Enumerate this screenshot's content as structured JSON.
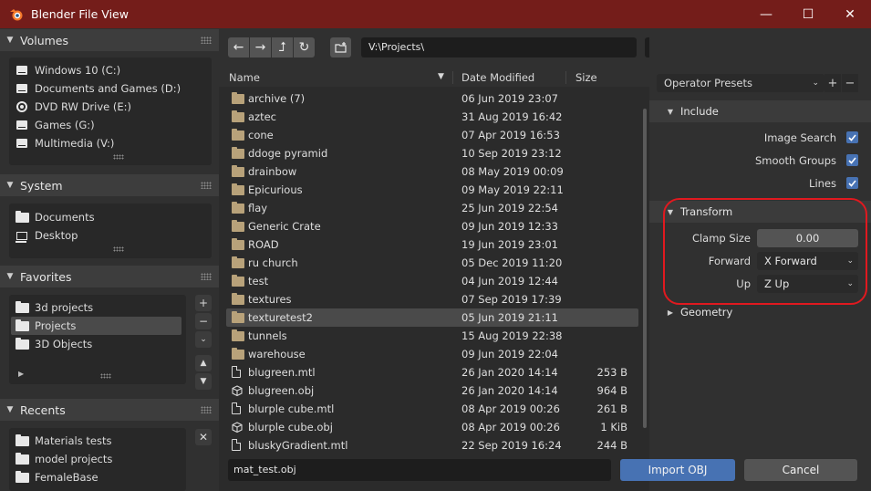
{
  "window": {
    "title": "Blender File View",
    "minimize": "—",
    "maximize": "☐",
    "close": "✕"
  },
  "sidebar": {
    "volumes": {
      "label": "Volumes",
      "items": [
        {
          "label": "Windows 10 (C:)",
          "icon": "drive-icon"
        },
        {
          "label": "Documents and Games (D:)",
          "icon": "drive-icon"
        },
        {
          "label": "DVD RW Drive (E:)",
          "icon": "disc-icon"
        },
        {
          "label": "Games (G:)",
          "icon": "drive-icon"
        },
        {
          "label": "Multimedia (V:)",
          "icon": "drive-icon"
        }
      ]
    },
    "system": {
      "label": "System",
      "items": [
        {
          "label": "Documents",
          "icon": "folder-icon"
        },
        {
          "label": "Desktop",
          "icon": "desktop-icon"
        }
      ]
    },
    "favorites": {
      "label": "Favorites",
      "items": [
        {
          "label": "3d projects",
          "icon": "folder-icon"
        },
        {
          "label": "Projects",
          "icon": "folder-icon",
          "selected": true
        },
        {
          "label": "3D Objects",
          "icon": "folder-icon"
        }
      ]
    },
    "recents": {
      "label": "Recents",
      "items": [
        {
          "label": "Materials tests",
          "icon": "folder-icon"
        },
        {
          "label": "model projects",
          "icon": "folder-icon"
        },
        {
          "label": "FemaleBase",
          "icon": "folder-icon"
        }
      ]
    }
  },
  "toolbar": {
    "path": "V:\\Projects\\"
  },
  "columns": {
    "name": "Name",
    "date": "Date Modified",
    "size": "Size"
  },
  "files": [
    {
      "name": "archive (7)",
      "date": "06 Jun 2019 23:07",
      "size": "",
      "type": "folder"
    },
    {
      "name": "aztec",
      "date": "31 Aug 2019 16:42",
      "size": "",
      "type": "folder"
    },
    {
      "name": "cone",
      "date": "07 Apr 2019 16:53",
      "size": "",
      "type": "folder"
    },
    {
      "name": "ddoge pyramid",
      "date": "10 Sep 2019 23:12",
      "size": "",
      "type": "folder"
    },
    {
      "name": "drainbow",
      "date": "08 May 2019 00:09",
      "size": "",
      "type": "folder"
    },
    {
      "name": "Epicurious",
      "date": "09 May 2019 22:11",
      "size": "",
      "type": "folder"
    },
    {
      "name": "flay",
      "date": "25 Jun 2019 22:54",
      "size": "",
      "type": "folder"
    },
    {
      "name": "Generic Crate",
      "date": "09 Jun 2019 12:33",
      "size": "",
      "type": "folder"
    },
    {
      "name": "ROAD",
      "date": "19 Jun 2019 23:01",
      "size": "",
      "type": "folder"
    },
    {
      "name": "ru church",
      "date": "05 Dec 2019 11:20",
      "size": "",
      "type": "folder"
    },
    {
      "name": "test",
      "date": "04 Jun 2019 12:44",
      "size": "",
      "type": "folder"
    },
    {
      "name": "textures",
      "date": "07 Sep 2019 17:39",
      "size": "",
      "type": "folder"
    },
    {
      "name": "texturetest2",
      "date": "05 Jun 2019 21:11",
      "size": "",
      "type": "folder",
      "selected": true
    },
    {
      "name": "tunnels",
      "date": "15 Aug 2019 22:38",
      "size": "",
      "type": "folder"
    },
    {
      "name": "warehouse",
      "date": "09 Jun 2019 22:04",
      "size": "",
      "type": "folder"
    },
    {
      "name": "blugreen.mtl",
      "date": "26 Jan 2020 14:14",
      "size": "253 B",
      "type": "file"
    },
    {
      "name": "blugreen.obj",
      "date": "26 Jan 2020 14:14",
      "size": "964 B",
      "type": "mesh"
    },
    {
      "name": "blurple cube.mtl",
      "date": "08 Apr 2019 00:26",
      "size": "261 B",
      "type": "file"
    },
    {
      "name": "blurple cube.obj",
      "date": "08 Apr 2019 00:26",
      "size": "1 KiB",
      "type": "mesh"
    },
    {
      "name": "bluskyGradient.mtl",
      "date": "22 Sep 2019 16:24",
      "size": "244 B",
      "type": "file"
    }
  ],
  "filename": "mat_test.obj",
  "operator": {
    "presets_label": "Operator Presets",
    "include": {
      "label": "Include",
      "options": [
        {
          "label": "Image Search",
          "checked": true
        },
        {
          "label": "Smooth Groups",
          "checked": true
        },
        {
          "label": "Lines",
          "checked": true
        }
      ]
    },
    "transform": {
      "label": "Transform",
      "clamp_label": "Clamp Size",
      "clamp_value": "0.00",
      "forward_label": "Forward",
      "forward_value": "X Forward",
      "up_label": "Up",
      "up_value": "Z Up"
    },
    "geometry": {
      "label": "Geometry"
    }
  },
  "actions": {
    "import": "Import OBJ",
    "cancel": "Cancel"
  },
  "colors": {
    "titlebar": "#741d1a",
    "accent": "#4772b3",
    "annotation": "#e0191f"
  }
}
